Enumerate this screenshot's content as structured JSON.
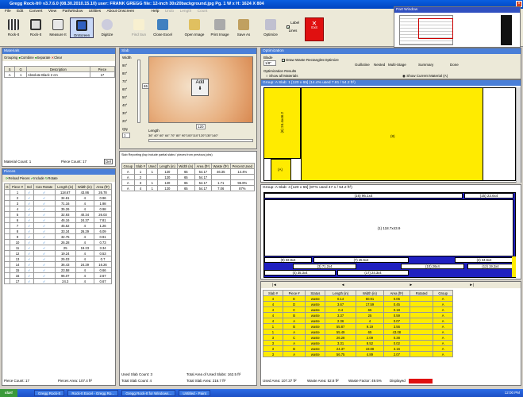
{
  "window": {
    "title": "Gregg Rock-It® v3.7.6.0 (08.30.2010.15.10) user: FRANK GREGG file: 12-inch 30x20background.jpg Pg. 1 W x H: 1624 X 804"
  },
  "menu": [
    "File",
    "Edit",
    "Convert",
    "View",
    "PartWindow",
    "Utilities",
    "About Onscreen",
    "Help",
    "Undo",
    "Length",
    "Count"
  ],
  "toolbar": {
    "left": [
      "Rock-It",
      "Rock-It",
      "Measure It",
      "OnScreen",
      "Digitize"
    ],
    "mid": [
      "Find Sun",
      "Close Excel",
      "Open Image",
      "Print Image",
      "Save As"
    ],
    "optimize": "Optimize",
    "label_lines": "Label Lines",
    "exit": "Exit"
  },
  "partwindow": {
    "title": "Part Window"
  },
  "materials": {
    "title": "Materials",
    "tools": [
      "Grouping",
      "Combine",
      "Separate",
      "Clear"
    ],
    "headers": [
      "S",
      "G",
      "Description",
      "Piece"
    ],
    "row": {
      "sel": "A",
      "g": "1",
      "desc": "Absolute Black 2 cm",
      "count": "17"
    },
    "footer_count": "Material Count: 1",
    "footer_pieces": "Piece Count: 17",
    "footer_btn": "Del"
  },
  "slab": {
    "title": "Slab",
    "width_label": "Width",
    "angles": [
      "90°",
      "80°",
      "70°",
      "60°",
      "50°",
      "40°",
      "30°",
      "20°"
    ],
    "qty_label": "Qty",
    "qty_value": "1",
    "length_label": "Length",
    "length_ticks": "36\" 40\" 60\" 64\" 70\" 80\" 90\"100\"110\"120\"130\"140\"",
    "add_label": "Add",
    "width_value": "65",
    "length_value": "120"
  },
  "slab_reporting": {
    "caption": "Slab Reporting (tap include partial slabs / pieces from previous jobs)",
    "headers": [
      "Group",
      "Slab #",
      "Used",
      "Length (in)",
      "Width (in)",
      "Area (ft²)",
      "Waste (ft²)",
      "Percent Used"
    ],
    "rows": [
      [
        "A",
        "1",
        "1",
        "120",
        "65",
        "54.17",
        "46.35",
        "14.4%"
      ],
      [
        "A",
        "2",
        "",
        "120",
        "65",
        "54.17",
        "",
        ""
      ],
      [
        "A",
        "3",
        "1",
        "120",
        "65",
        "54.17",
        "1.71",
        "96.8%"
      ],
      [
        "A",
        "4",
        "1",
        "120",
        "65",
        "54.17",
        "7.06",
        "87%"
      ]
    ],
    "used_slab": "Used Slab Count: 3",
    "total_slab": "Total Slab Count: 4",
    "total_area_used": "Total Area of Used Slabs: 162.5 ft²",
    "total_slab_area": "Total Slab Area: 216.7 ft²"
  },
  "pieces": {
    "title": "Pieces",
    "tools": [
      "Reload Pieces",
      "Include",
      "Rotate"
    ],
    "headers": [
      "G",
      "Piece #",
      "Incl",
      "Can Rotate",
      "Length (in)",
      "Width (in)",
      "Area (ft²)"
    ],
    "rows": [
      [
        "1",
        "✓",
        "✓",
        "118.67",
        "43.86",
        "26.78"
      ],
      [
        "2",
        "✓",
        "✓",
        "34.61",
        "4",
        "0.96"
      ],
      [
        "3",
        "✓",
        "✓",
        "71.16",
        "4",
        "1.98"
      ],
      [
        "4",
        "✓",
        "✓",
        "35.26",
        "4",
        "0.98"
      ],
      [
        "5",
        "✓",
        "✓",
        "32.93",
        "40.34",
        "26.03"
      ],
      [
        "6",
        "✓",
        "✓",
        "46.16",
        "24.37",
        "7.81"
      ],
      [
        "7",
        "✓",
        "✓",
        "45.52",
        "4",
        "1.26"
      ],
      [
        "8",
        "✓",
        "✓",
        "33.34",
        "26.29",
        "6.09"
      ],
      [
        "9",
        "✓",
        "✓",
        "32.75",
        "4",
        "0.91"
      ],
      [
        "10",
        "✓",
        "✓",
        "26.28",
        "4",
        "0.73"
      ],
      [
        "11",
        "✓",
        "✓",
        "25",
        "19.23",
        "3.34"
      ],
      [
        "12",
        "✓",
        "✓",
        "19.24",
        "4",
        "0.53"
      ],
      [
        "13",
        "✓",
        "✓",
        "25.03",
        "4",
        "0.7"
      ],
      [
        "14",
        "✓",
        "✓",
        "36.43",
        "24.29",
        "16.26"
      ],
      [
        "15",
        "✓",
        "✓",
        "23.58",
        "4",
        "0.66"
      ],
      [
        "16",
        "✓",
        "✓",
        "96.07",
        "4",
        "2.67"
      ],
      [
        "17",
        "✓",
        "✓",
        "24.3",
        "4",
        "0.67"
      ]
    ],
    "footer_count": "Piece Count: 17",
    "footer_area": "Pieces Area: 107.4 ft²"
  },
  "optimization": {
    "title": "Optimization",
    "blade_label": "Blade",
    "blade_value": "1/8\"",
    "draw_waste": "Draw Waste Rectangles",
    "optimize": "Optimize",
    "guillotine": "Guillotine",
    "nested": "Nested",
    "multistage": "Multi-Stage",
    "summary": "Summary",
    "done": "Done",
    "results_label": "Optimization Results",
    "show_all": "Show all Materials",
    "show_current": "Show Current Material (A)"
  },
  "slab1": {
    "title": "Group: A Slab: 1  [120 x 65] (14.4% used 7.81 / 54.2 ft²)",
    "piece_left": "(6) 24.4x46.2",
    "piece_right": "(8)",
    "piece_small": "(A)"
  },
  "slab4": {
    "title": "Group: A Slab: 4  [120 x 65] (87% used 47.1 / 54.2 ft²)",
    "top_strip": "(16) 96.1x4",
    "top_strip_r": "(15) 23.6x4",
    "main": "(1) 118.7x43.9",
    "strips": [
      "(9) 32.8x4",
      "(7) 45.5x4",
      "(2) 34.6x4",
      "(3) 71.2x4",
      "(10) 26x4",
      "(12) 19.2x4",
      "(4) 35.3x4",
      "(17) 24.3x4"
    ]
  },
  "waste": {
    "headers": [
      "Slab #",
      "Piece #",
      "Status",
      "Length (in)",
      "Width (in)",
      "Area (ft²)",
      "Rotated",
      "Group"
    ],
    "rows": [
      [
        "4",
        "E",
        "waste",
        "0.14",
        "60.91",
        "0.06",
        "",
        "A"
      ],
      [
        "4",
        "D",
        "waste",
        "3.67",
        "17.59",
        "0.45",
        "",
        "A"
      ],
      [
        "4",
        "C",
        "waste",
        "0.4",
        "65",
        "0.18",
        "",
        "A"
      ],
      [
        "4",
        "B",
        "waste",
        "3.37",
        "25",
        "0.59",
        "",
        "A"
      ],
      [
        "4",
        "A",
        "waste",
        "2.36",
        "4",
        "0.07",
        "",
        "A"
      ],
      [
        "1",
        "B",
        "waste",
        "55.87",
        "9.19",
        "3.56",
        "",
        "A"
      ],
      [
        "1",
        "A",
        "waste",
        "55.49",
        "65",
        "43.08",
        "",
        "A"
      ],
      [
        "3",
        "C",
        "waste",
        "26.28",
        "2.09",
        "0.38",
        "",
        "A"
      ],
      [
        "3",
        "A",
        "waste",
        "3.31",
        "8.52",
        "0.02",
        "",
        "A"
      ],
      [
        "3",
        "B",
        "waste",
        "24.37",
        "19.88",
        "3.16",
        "",
        "A"
      ],
      [
        "3",
        "A",
        "waste",
        "56.75",
        "4.89",
        "2.07",
        "",
        "A"
      ]
    ],
    "used_area": "Used Area: 107.37 ft²",
    "waste_area": "Waste Area: 52.8 ft²",
    "waste_factor": "Waste Factor: 49.5%",
    "displayed": "Displayed"
  },
  "taskbar": {
    "start": "start",
    "items": [
      "Gregg Rock-It",
      "Rock-It Excel - Gregg Ro...",
      "Gregg Rock-It for Windows...",
      "Untitled - Paint"
    ],
    "clock": "12:00 PM"
  }
}
